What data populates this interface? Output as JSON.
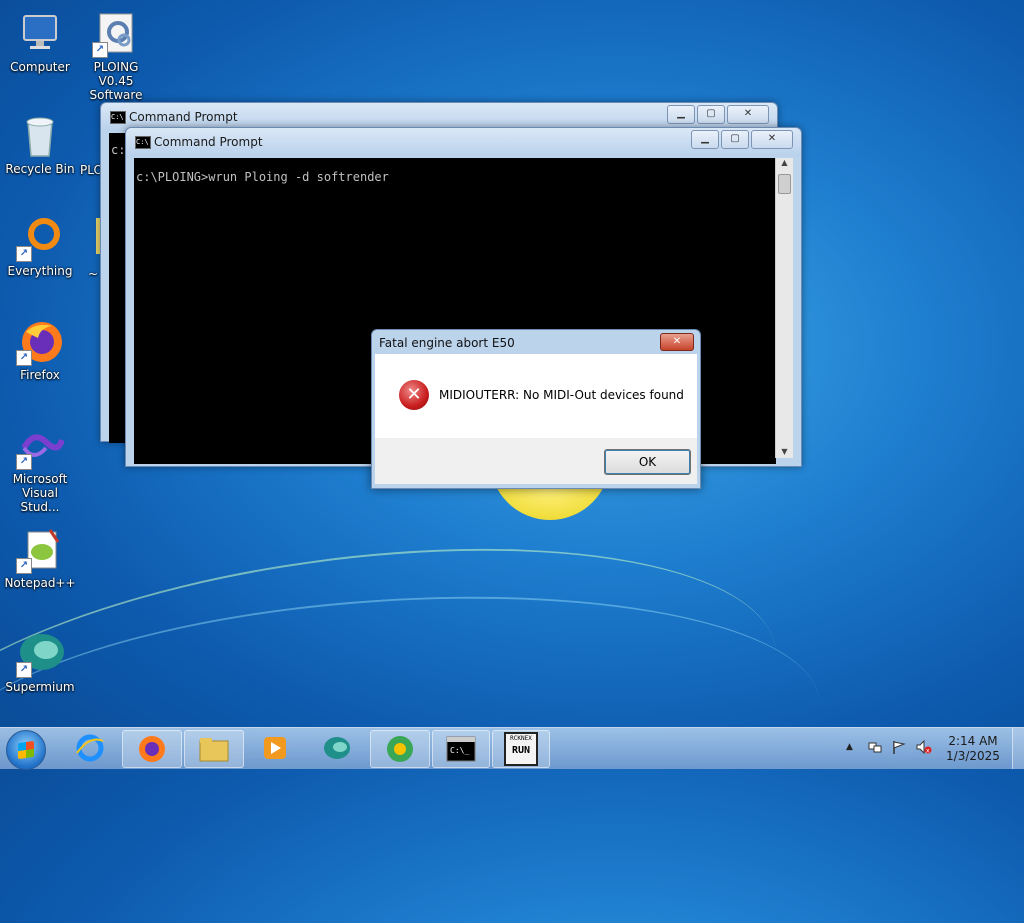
{
  "desktop": {
    "icons": [
      {
        "label": "Computer",
        "icon": "computer-icon"
      },
      {
        "label": "PLOING V0.45 Software m...",
        "icon": "ploing-app-icon"
      },
      {
        "label": "Recycle Bin",
        "icon": "recycle-bin-icon"
      },
      {
        "label": "PLO",
        "icon": "ploing-folder-icon"
      },
      {
        "label": "Everything",
        "icon": "everything-search-icon"
      },
      {
        "label": "~",
        "icon": "folder-icon"
      },
      {
        "label": "Firefox",
        "icon": "firefox-icon"
      },
      {
        "label": "Microsoft Visual Stud...",
        "icon": "visual-studio-icon"
      },
      {
        "label": "Notepad++",
        "icon": "notepad-plus-plus-icon"
      },
      {
        "label": "Supermium",
        "icon": "supermium-icon"
      }
    ]
  },
  "back_window": {
    "title": "Command Prompt",
    "console_prefix": "c:"
  },
  "front_window": {
    "title": "Command Prompt",
    "console_line": "c:\\PLOING>wrun Ploing -d softrender"
  },
  "dialog": {
    "title": "Fatal engine abort E50",
    "message": "MIDIOUTERR: No MIDI-Out devices found",
    "ok_label": "OK",
    "icon": "error-icon"
  },
  "taskbar": {
    "buttons": [
      {
        "name": "internet-explorer",
        "icon": "internet-explorer-icon"
      },
      {
        "name": "firefox",
        "icon": "firefox-icon"
      },
      {
        "name": "windows-explorer",
        "icon": "folder-icon"
      },
      {
        "name": "media-player",
        "icon": "media-player-icon"
      },
      {
        "name": "supermium",
        "icon": "supermium-icon"
      },
      {
        "name": "chrome-like",
        "icon": "browser-icon"
      },
      {
        "name": "command-prompt",
        "icon": "cmd-icon"
      },
      {
        "name": "rcknex-run",
        "icon": "rcknex-run-icon"
      }
    ],
    "rcknex_top": "RCKNEX",
    "rcknex_bottom": "RUN",
    "clock_time": "2:14 AM",
    "clock_date": "1/3/2025"
  }
}
